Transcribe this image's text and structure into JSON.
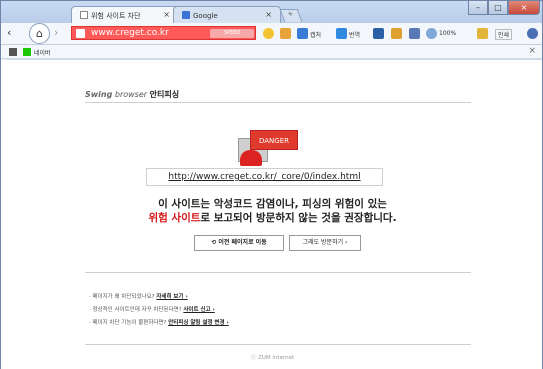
{
  "browser": {
    "tabs": [
      {
        "label": "위험 사이트 차단",
        "close": "×"
      },
      {
        "label": "Google",
        "close": "×"
      }
    ],
    "new_tab": "+",
    "window_buttons": [
      "–",
      "□",
      "×"
    ],
    "address": {
      "url": "www.creget.co.kr",
      "badge": "SPEED"
    },
    "toolbar": {
      "capture": "캡처",
      "translate": "번역",
      "zoom": "100%",
      "print": "인쇄"
    },
    "bookmarks": {
      "label": "네이버",
      "close": "×"
    }
  },
  "page": {
    "brand_name": "Swing",
    "brand_suffix": " browser ",
    "brand_sub": "안티피싱",
    "danger_label": "DANGER",
    "blocked_url": "http://www.creget.co.kr/_core/0/index.html",
    "message_line1": "이 사이트는 악성코드 감염이나, 피싱의 위험이 있는",
    "message_line2_red": "위험 사이트",
    "message_line2_rest": "로 보고되어 방문하지 않는 것을 권장합니다.",
    "back_button": "⟲  이전 페이지로 이동",
    "proceed_button": "그래도 방문하기 ›",
    "links": [
      {
        "prefix": "· 페이지가 왜 차단되었나요? ",
        "link": "자세히 보기 ›"
      },
      {
        "prefix": "· 정상적인 사이트인데 자꾸 차단된다면? ",
        "link": "사이트 신고 ›"
      },
      {
        "prefix": "· 페이지 차단 기능이 불편하다면? ",
        "link": "안티피싱 알림 설정 변경 ›"
      }
    ],
    "footer": "ⓒ ZUM internet"
  },
  "colors": {
    "danger_red": "#d6191b",
    "address_red": "#ff5a5a"
  }
}
